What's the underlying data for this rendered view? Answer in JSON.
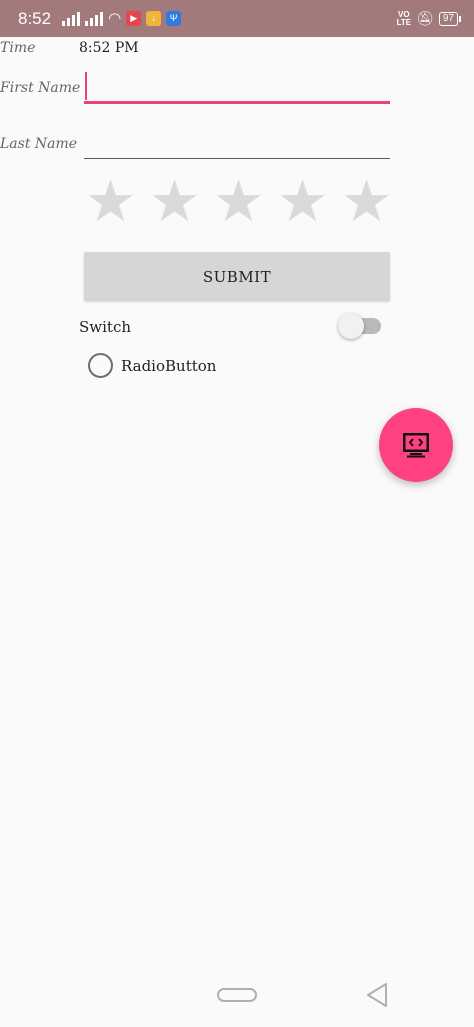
{
  "status_bar": {
    "time": "8:52",
    "volte": "VO\nLTE",
    "battery": "97",
    "icon_names": [
      "signal-icon",
      "signal-icon",
      "wifi-icon",
      "video-icon",
      "download-icon",
      "usb-icon",
      "volte-icon",
      "mute-icon",
      "battery-icon"
    ]
  },
  "form": {
    "time_label": "Time",
    "time_value": "8:52 PM",
    "first_name_label": "First Name",
    "first_name_value": "",
    "last_name_label": "Last Name",
    "last_name_value": "",
    "rating": {
      "value": 0,
      "max": 5
    },
    "submit_label": "SUBMIT",
    "switch_label": "Switch",
    "switch_on": false,
    "radio_label": "RadioButton",
    "radio_checked": false
  },
  "fab": {
    "icon": "screen-code-icon"
  },
  "colors": {
    "status_bar": "#a27a7c",
    "accent": "#e8437f",
    "fab": "#ff4081",
    "star_empty": "#dadada",
    "button": "#d6d6d6"
  },
  "nav": {
    "icons": [
      "home-pill-icon",
      "back-icon"
    ]
  }
}
